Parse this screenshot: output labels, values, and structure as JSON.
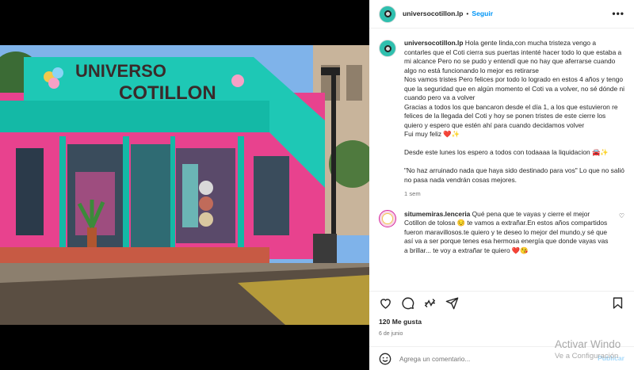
{
  "post": {
    "username": "universocotillon.lp",
    "separator": "•",
    "follow_label": "Seguir",
    "more_label": "•••",
    "photo_sign": {
      "line1": "UNIVERSO",
      "line2": "COTILLON"
    },
    "caption_user": "universocotillon.lp",
    "caption": " Hola gente linda,con mucha tristeza vengo a contarles que el Coti cierra sus puertas intenté hacer todo lo que estaba a mi alcance Pero no se pudo y entendí que no hay que aferrarse cuando algo no está funcionando lo mejor es retirarse\nNos vamos tristes Pero felices por todo lo logrado en estos 4 años y tengo que la seguridad que en algún momento el Coti va a volver, no sé dónde ni cuando pero va a volver\nGracias a todos los que bancaron desde el día 1, a los que estuvieron re felices de la llegada del Coti y hoy se ponen tristes de este cierre los quiero y espero que estén ahí para cuando decidamos volver\nFui muy feliz ❤️✨\n\nDesde este lunes los espero a todos con todaaaa la liquidacion 🚘✨\n\n\"No haz arruinado nada que haya sido destinado para vos\" Lo que no salió no pasa nada vendrán cosas mejores.",
    "caption_time": "1 sem",
    "comment": {
      "username": "situmemiras.lenceria",
      "text": " Qué pena que te vayas y cierre el mejor Cotillon de tolosa 😔 te vamos a extrañar.En estos años compartidos fueron maravillosos.te quiero y te deseo lo mejor del mundo,y sé que así va a ser porque tenes esa hermosa energía que donde vayas vas a brillar... te voy a extrañar te quiero ❤️😘"
    },
    "likes": "120 Me gusta",
    "date": "6 de junio",
    "add_comment_placeholder": "Agrega un comentario...",
    "publish_label": "Publicar"
  },
  "watermark": {
    "line1": "Activar Windo",
    "line2": "Ve a Configuración"
  },
  "colors": {
    "accent": "#0095f6",
    "sign": "#1ec8b5",
    "storefront": "#e8428e"
  },
  "icons": [
    "more-icon",
    "like-icon",
    "comment-icon",
    "share-icon",
    "save-icon",
    "emoji-icon",
    "heart-icon"
  ]
}
